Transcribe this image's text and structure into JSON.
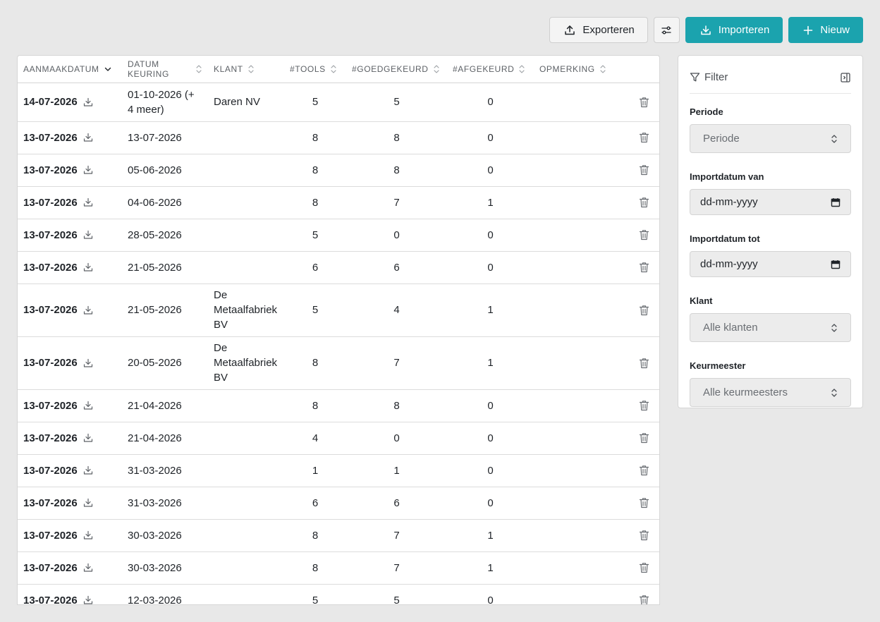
{
  "toolbar": {
    "export_label": "Exporteren",
    "import_label": "Importeren",
    "new_label": "Nieuw"
  },
  "colors": {
    "primary": "#1ba3ae",
    "background": "#e8e8e8"
  },
  "table": {
    "headers": {
      "aanmaakdatum": "AANMAAKDATUM",
      "datum_keuring": "DATUM KEURING",
      "klant": "KLANT",
      "tools": "#TOOLS",
      "goedgekeurd": "#GOEDGEKEURD",
      "afgekeurd": "#AFGEKEURD",
      "opmerking": "OPMERKING"
    },
    "rows": [
      {
        "aanmaak": "14-07-2026",
        "keuring": "01-10-2026 (+ 4 meer)",
        "klant": "Daren NV",
        "tools": "5",
        "goed": "5",
        "af": "0",
        "opmerking": ""
      },
      {
        "aanmaak": "13-07-2026",
        "keuring": "13-07-2026",
        "klant": "",
        "tools": "8",
        "goed": "8",
        "af": "0",
        "opmerking": ""
      },
      {
        "aanmaak": "13-07-2026",
        "keuring": "05-06-2026",
        "klant": "",
        "tools": "8",
        "goed": "8",
        "af": "0",
        "opmerking": ""
      },
      {
        "aanmaak": "13-07-2026",
        "keuring": "04-06-2026",
        "klant": "",
        "tools": "8",
        "goed": "7",
        "af": "1",
        "opmerking": ""
      },
      {
        "aanmaak": "13-07-2026",
        "keuring": "28-05-2026",
        "klant": "",
        "tools": "5",
        "goed": "0",
        "af": "0",
        "opmerking": ""
      },
      {
        "aanmaak": "13-07-2026",
        "keuring": "21-05-2026",
        "klant": "",
        "tools": "6",
        "goed": "6",
        "af": "0",
        "opmerking": ""
      },
      {
        "aanmaak": "13-07-2026",
        "keuring": "21-05-2026",
        "klant": "De Metaalfabriek BV",
        "tools": "5",
        "goed": "4",
        "af": "1",
        "opmerking": ""
      },
      {
        "aanmaak": "13-07-2026",
        "keuring": "20-05-2026",
        "klant": "De Metaalfabriek BV",
        "tools": "8",
        "goed": "7",
        "af": "1",
        "opmerking": ""
      },
      {
        "aanmaak": "13-07-2026",
        "keuring": "21-04-2026",
        "klant": "",
        "tools": "8",
        "goed": "8",
        "af": "0",
        "opmerking": ""
      },
      {
        "aanmaak": "13-07-2026",
        "keuring": "21-04-2026",
        "klant": "",
        "tools": "4",
        "goed": "0",
        "af": "0",
        "opmerking": ""
      },
      {
        "aanmaak": "13-07-2026",
        "keuring": "31-03-2026",
        "klant": "",
        "tools": "1",
        "goed": "1",
        "af": "0",
        "opmerking": ""
      },
      {
        "aanmaak": "13-07-2026",
        "keuring": "31-03-2026",
        "klant": "",
        "tools": "6",
        "goed": "6",
        "af": "0",
        "opmerking": ""
      },
      {
        "aanmaak": "13-07-2026",
        "keuring": "30-03-2026",
        "klant": "",
        "tools": "8",
        "goed": "7",
        "af": "1",
        "opmerking": ""
      },
      {
        "aanmaak": "13-07-2026",
        "keuring": "30-03-2026",
        "klant": "",
        "tools": "8",
        "goed": "7",
        "af": "1",
        "opmerking": ""
      },
      {
        "aanmaak": "13-07-2026",
        "keuring": "12-03-2026",
        "klant": "",
        "tools": "5",
        "goed": "5",
        "af": "0",
        "opmerking": ""
      }
    ]
  },
  "filter": {
    "title": "Filter",
    "periode_label": "Periode",
    "periode_value": "Periode",
    "van_label": "Importdatum van",
    "van_placeholder": "dd-mm-yyyy",
    "tot_label": "Importdatum tot",
    "tot_placeholder": "dd-mm-yyyy",
    "klant_label": "Klant",
    "klant_value": "Alle klanten",
    "keurmeester_label": "Keurmeester",
    "keurmeester_value": "Alle keurmeesters"
  }
}
